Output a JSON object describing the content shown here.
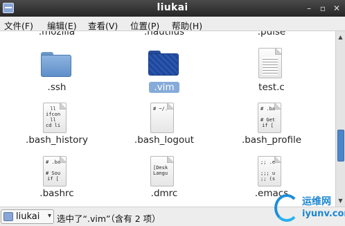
{
  "window": {
    "title": "liukai"
  },
  "menubar": {
    "items": [
      "文件(F)",
      "编辑(E)",
      "查看(V)",
      "位置(P)",
      "帮助(H)"
    ]
  },
  "files": [
    {
      "name": ".mozilla",
      "type": "folder"
    },
    {
      "name": ".nautilus",
      "type": "folder"
    },
    {
      "name": ".pulse",
      "type": "folder"
    },
    {
      "name": ".ssh",
      "type": "folder"
    },
    {
      "name": ".vim",
      "type": "folder",
      "selected": true
    },
    {
      "name": "test.c",
      "type": "text"
    },
    {
      "name": ".bash_history",
      "type": "text",
      "preview": "ll\nifcon\nll\ncd li"
    },
    {
      "name": ".bash_logout",
      "type": "text",
      "preview": "# ~/."
    },
    {
      "name": ".bash_profile",
      "type": "text",
      "preview": "# .ba\n\n# Get\nif ["
    },
    {
      "name": ".bashrc",
      "type": "text",
      "preview": "# .ba\n\n# Sou\nif ["
    },
    {
      "name": ".dmrc",
      "type": "text",
      "preview": "[Desk\nLangu"
    },
    {
      "name": ".emacs",
      "type": "text",
      "preview": ";; .e\n\n;;; u\n;; (s"
    }
  ],
  "statusbar": {
    "location": "liukai",
    "status": "选中了“.vim”（含有 2 项）"
  },
  "watermark": {
    "cn": "运维网",
    "en": "iyunv.com"
  },
  "colors": {
    "selection": "#86abd9",
    "folder": "#6b98c9",
    "selected_folder": "#2a56b0",
    "titlebar": "#2f2f2f"
  },
  "icons": {
    "app": "folder-window-icon",
    "minimize": "minimize-icon",
    "maximize": "maximize-icon",
    "close": "close-icon"
  }
}
